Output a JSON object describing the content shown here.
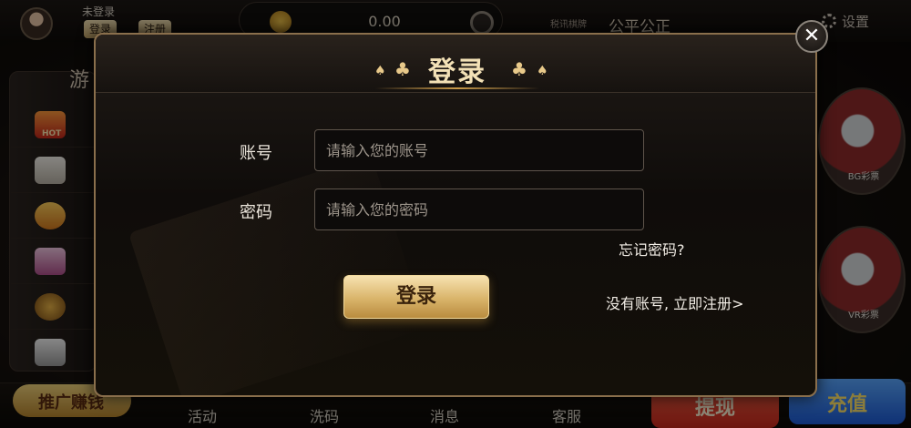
{
  "topbar": {
    "login_status": "未登录",
    "login_button": "登录",
    "register_button": "注册",
    "balance": "0.00",
    "fairness_logo": "税讯棋牌",
    "fairness_text": "公平公正",
    "settings_label": "设置"
  },
  "sidebar": {
    "title": "游",
    "hot_badge": "HOT"
  },
  "right_games": [
    {
      "label": "BG彩票"
    },
    {
      "label": "VR彩票"
    }
  ],
  "bottom_nav": {
    "promo": "推广赚钱",
    "items": [
      "活动",
      "洗码",
      "消息",
      "客服"
    ],
    "withdraw": "提现",
    "recharge": "充值"
  },
  "login_modal": {
    "title": "登录",
    "account_label": "账号",
    "account_placeholder": "请输入您的账号",
    "password_label": "密码",
    "password_placeholder": "请输入您的密码",
    "forgot_password": "忘记密码?",
    "register_prompt": "没有账号, 立即注册>",
    "submit_label": "登录",
    "close_label": "✕"
  },
  "colors": {
    "gold_accent": "#d9b46a",
    "modal_border": "#8a6f4c",
    "background": "#0b0908"
  }
}
